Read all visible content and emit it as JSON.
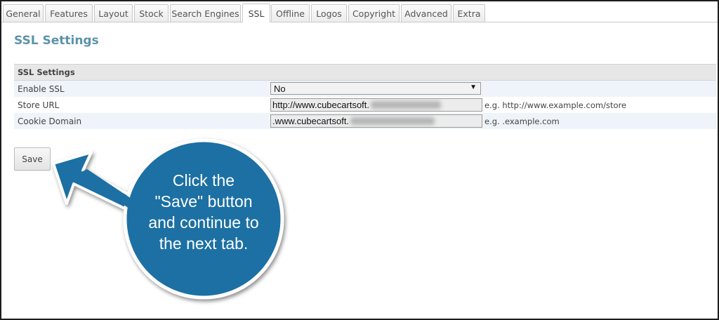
{
  "tabs": [
    {
      "label": "General"
    },
    {
      "label": "Features"
    },
    {
      "label": "Layout"
    },
    {
      "label": "Stock"
    },
    {
      "label": "Search Engines"
    },
    {
      "label": "SSL"
    },
    {
      "label": "Offline"
    },
    {
      "label": "Logos"
    },
    {
      "label": "Copyright"
    },
    {
      "label": "Advanced"
    },
    {
      "label": "Extra"
    }
  ],
  "active_tab": "SSL",
  "page": {
    "title": "SSL Settings"
  },
  "section": {
    "heading": "SSL Settings",
    "rows": [
      {
        "label": "Enable SSL",
        "value": "No",
        "hint": ""
      },
      {
        "label": "Store URL",
        "value": "http://www.cubecartsoft.",
        "hint": "e.g. http://www.example.com/store"
      },
      {
        "label": "Cookie Domain",
        "value": ".www.cubecartsoft.",
        "hint": "e.g. .example.com"
      }
    ]
  },
  "save_button": {
    "label": "Save"
  },
  "callout": {
    "lines": [
      "Click the",
      "\"Save\" button",
      "and continue to",
      "the next tab."
    ],
    "color": "#1d6fa3"
  },
  "colors": {
    "title": "#5b93aa",
    "alt_row": "#eef4f9",
    "section_head": "#e7e7e7"
  }
}
